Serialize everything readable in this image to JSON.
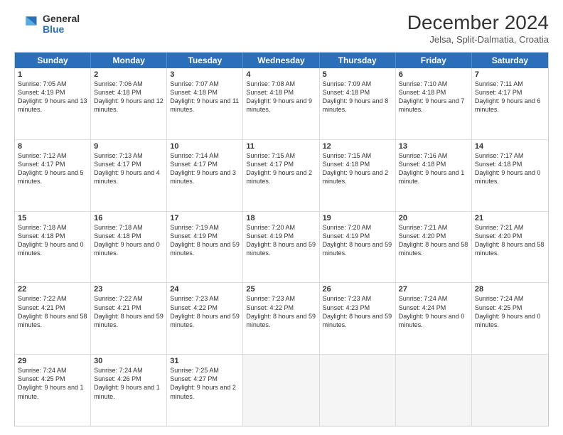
{
  "header": {
    "logo_general": "General",
    "logo_blue": "Blue",
    "title": "December 2024",
    "location": "Jelsa, Split-Dalmatia, Croatia"
  },
  "days_of_week": [
    "Sunday",
    "Monday",
    "Tuesday",
    "Wednesday",
    "Thursday",
    "Friday",
    "Saturday"
  ],
  "weeks": [
    [
      {
        "day": 1,
        "sunrise": "7:05 AM",
        "sunset": "4:19 PM",
        "daylight": "9 hours and 13 minutes."
      },
      {
        "day": 2,
        "sunrise": "7:06 AM",
        "sunset": "4:18 PM",
        "daylight": "9 hours and 12 minutes."
      },
      {
        "day": 3,
        "sunrise": "7:07 AM",
        "sunset": "4:18 PM",
        "daylight": "9 hours and 11 minutes."
      },
      {
        "day": 4,
        "sunrise": "7:08 AM",
        "sunset": "4:18 PM",
        "daylight": "9 hours and 9 minutes."
      },
      {
        "day": 5,
        "sunrise": "7:09 AM",
        "sunset": "4:18 PM",
        "daylight": "9 hours and 8 minutes."
      },
      {
        "day": 6,
        "sunrise": "7:10 AM",
        "sunset": "4:18 PM",
        "daylight": "9 hours and 7 minutes."
      },
      {
        "day": 7,
        "sunrise": "7:11 AM",
        "sunset": "4:17 PM",
        "daylight": "9 hours and 6 minutes."
      }
    ],
    [
      {
        "day": 8,
        "sunrise": "7:12 AM",
        "sunset": "4:17 PM",
        "daylight": "9 hours and 5 minutes."
      },
      {
        "day": 9,
        "sunrise": "7:13 AM",
        "sunset": "4:17 PM",
        "daylight": "9 hours and 4 minutes."
      },
      {
        "day": 10,
        "sunrise": "7:14 AM",
        "sunset": "4:17 PM",
        "daylight": "9 hours and 3 minutes."
      },
      {
        "day": 11,
        "sunrise": "7:15 AM",
        "sunset": "4:17 PM",
        "daylight": "9 hours and 2 minutes."
      },
      {
        "day": 12,
        "sunrise": "7:15 AM",
        "sunset": "4:18 PM",
        "daylight": "9 hours and 2 minutes."
      },
      {
        "day": 13,
        "sunrise": "7:16 AM",
        "sunset": "4:18 PM",
        "daylight": "9 hours and 1 minute."
      },
      {
        "day": 14,
        "sunrise": "7:17 AM",
        "sunset": "4:18 PM",
        "daylight": "9 hours and 0 minutes."
      }
    ],
    [
      {
        "day": 15,
        "sunrise": "7:18 AM",
        "sunset": "4:18 PM",
        "daylight": "9 hours and 0 minutes."
      },
      {
        "day": 16,
        "sunrise": "7:18 AM",
        "sunset": "4:18 PM",
        "daylight": "9 hours and 0 minutes."
      },
      {
        "day": 17,
        "sunrise": "7:19 AM",
        "sunset": "4:19 PM",
        "daylight": "8 hours and 59 minutes."
      },
      {
        "day": 18,
        "sunrise": "7:20 AM",
        "sunset": "4:19 PM",
        "daylight": "8 hours and 59 minutes."
      },
      {
        "day": 19,
        "sunrise": "7:20 AM",
        "sunset": "4:19 PM",
        "daylight": "8 hours and 59 minutes."
      },
      {
        "day": 20,
        "sunrise": "7:21 AM",
        "sunset": "4:20 PM",
        "daylight": "8 hours and 58 minutes."
      },
      {
        "day": 21,
        "sunrise": "7:21 AM",
        "sunset": "4:20 PM",
        "daylight": "8 hours and 58 minutes."
      }
    ],
    [
      {
        "day": 22,
        "sunrise": "7:22 AM",
        "sunset": "4:21 PM",
        "daylight": "8 hours and 58 minutes."
      },
      {
        "day": 23,
        "sunrise": "7:22 AM",
        "sunset": "4:21 PM",
        "daylight": "8 hours and 59 minutes."
      },
      {
        "day": 24,
        "sunrise": "7:23 AM",
        "sunset": "4:22 PM",
        "daylight": "8 hours and 59 minutes."
      },
      {
        "day": 25,
        "sunrise": "7:23 AM",
        "sunset": "4:22 PM",
        "daylight": "8 hours and 59 minutes."
      },
      {
        "day": 26,
        "sunrise": "7:23 AM",
        "sunset": "4:23 PM",
        "daylight": "8 hours and 59 minutes."
      },
      {
        "day": 27,
        "sunrise": "7:24 AM",
        "sunset": "4:24 PM",
        "daylight": "9 hours and 0 minutes."
      },
      {
        "day": 28,
        "sunrise": "7:24 AM",
        "sunset": "4:25 PM",
        "daylight": "9 hours and 0 minutes."
      }
    ],
    [
      {
        "day": 29,
        "sunrise": "7:24 AM",
        "sunset": "4:25 PM",
        "daylight": "9 hours and 1 minute."
      },
      {
        "day": 30,
        "sunrise": "7:24 AM",
        "sunset": "4:26 PM",
        "daylight": "9 hours and 1 minute."
      },
      {
        "day": 31,
        "sunrise": "7:25 AM",
        "sunset": "4:27 PM",
        "daylight": "9 hours and 2 minutes."
      },
      null,
      null,
      null,
      null
    ]
  ]
}
